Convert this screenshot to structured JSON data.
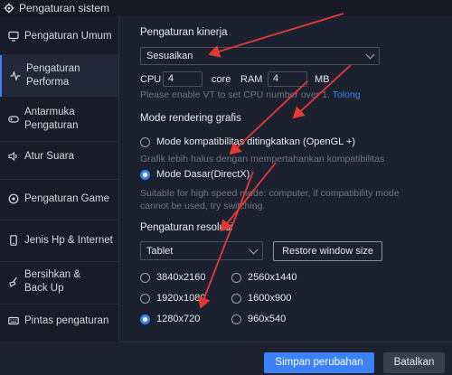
{
  "window": {
    "title": "Pengaturan sistem"
  },
  "sidebar": {
    "items": [
      {
        "label": "Pengaturan Umum",
        "icon": "monitor-icon"
      },
      {
        "label": "Pengaturan Performa",
        "icon": "pulse-icon"
      },
      {
        "label": "Antarmuka Pengaturan",
        "icon": "gamepad-icon"
      },
      {
        "label": "Atur Suara",
        "icon": "speaker-icon"
      },
      {
        "label": "Pengaturan Game",
        "icon": "target-icon"
      },
      {
        "label": "Jenis Hp & Internet",
        "icon": "phone-icon"
      },
      {
        "label": "Bersihkan & Back Up",
        "icon": "broom-icon"
      },
      {
        "label": "Pintas pengaturan",
        "icon": "keyboard-icon"
      }
    ],
    "active_index": 1
  },
  "performance": {
    "heading": "Pengaturan kinerja",
    "selected": "Sesuaikan",
    "cpu_label": "CPU",
    "cpu_value": "4",
    "core_label": "core",
    "ram_label": "RAM",
    "ram_value": "4",
    "mb_label": "MB",
    "hint_text": "Please enable VT to set CPU number over 1.",
    "hint_link": "Tolong"
  },
  "rendering": {
    "heading": "Mode rendering grafis",
    "option1_label": "Mode kompatibilitas ditingkatkan (OpenGL +)",
    "option1_desc": "Grafik lebih halus dengan mempertahankan kompatibilitas",
    "option2_label": "Mode Dasar(DirectX)",
    "option2_desc": "Suitable for high speed mode: computer, if compatibility mode cannot be used, try switching.",
    "selected": "Mode Dasar(DirectX)"
  },
  "resolution": {
    "heading": "Pengaturan resolusi",
    "device": "Tablet",
    "restore_label": "Restore window size",
    "options": [
      "3840x2160",
      "2560x1440",
      "1920x1080",
      "1600x900",
      "1280x720",
      "960x540"
    ],
    "selected": "1280x720"
  },
  "footer": {
    "save_label": "Simpan perubahan",
    "cancel_label": "Batalkan"
  },
  "colors": {
    "accent": "#3b82f6",
    "annotation": "#e53935"
  }
}
